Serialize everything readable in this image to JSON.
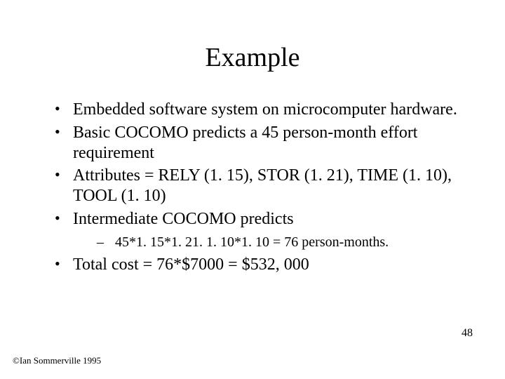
{
  "title": "Example",
  "bullets": [
    {
      "text": "Embedded software system on microcomputer hardware."
    },
    {
      "text": "Basic COCOMO predicts a 45 person-month effort requirement"
    },
    {
      "text": "Attributes = RELY (1. 15), STOR (1. 21), TIME (1. 10), TOOL (1. 10)"
    },
    {
      "text": "Intermediate COCOMO predicts",
      "sub": [
        {
          "text": "45*1. 15*1. 21. 1. 10*1. 10 = 76 person-months."
        }
      ]
    },
    {
      "text": "Total cost = 76*$7000 = $532, 000"
    }
  ],
  "pageNumber": "48",
  "copyright": "©Ian Sommerville 1995"
}
